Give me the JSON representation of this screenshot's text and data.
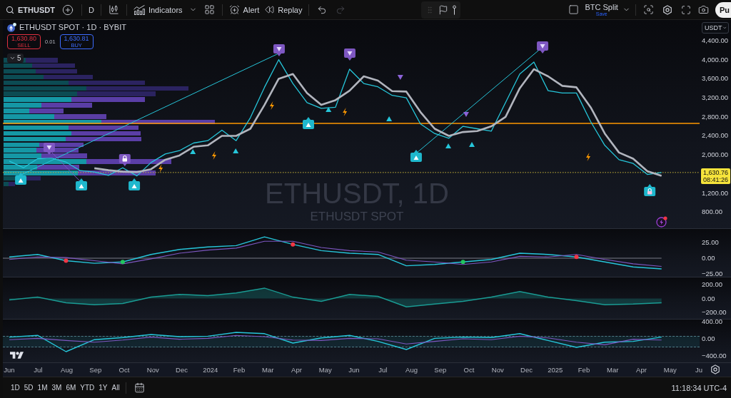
{
  "toolbar": {
    "symbol": "ETHUSDT",
    "interval": "D",
    "indicators": "Indicators",
    "alert": "Alert",
    "replay": "Replay",
    "undo": {
      "disabled": false
    },
    "redo": {
      "disabled": true
    },
    "layout": {
      "name": "BTC Split",
      "status": "Save"
    },
    "publish": "Pu"
  },
  "legend": {
    "title": "ETHUSDT SPOT · 1D · BYBIT",
    "sell": {
      "price": "1,630.80",
      "label": "SELL"
    },
    "spread": "0.01",
    "buy": {
      "price": "1,630.81",
      "label": "BUY"
    },
    "indicator_count": "5"
  },
  "watermark": {
    "symbol": "ETHUSDT, 1D",
    "description": "ETHUSDT SPOT"
  },
  "price_axis": {
    "currency": "USDT",
    "last_price": "1,630.76",
    "countdown": "08:41:26"
  },
  "main_chart": {
    "chart_data": {
      "type": "line",
      "categories": [
        null,
        null,
        null,
        null,
        null,
        null,
        null,
        null,
        null,
        null,
        null,
        null,
        null,
        null,
        null,
        null,
        null,
        null,
        null,
        null,
        null,
        null,
        null,
        null,
        null,
        null,
        null,
        null,
        null,
        null,
        null,
        null,
        null,
        null,
        null,
        null,
        null,
        null,
        null,
        null,
        null,
        null,
        null,
        null,
        null,
        null,
        null
      ],
      "series": [
        {
          "color": "#26c6da",
          "values": [
            1870,
            1730,
            1920,
            1930,
            1850,
            1670,
            1640,
            1570,
            1730,
            1560,
            1840,
            2020,
            2090,
            2250,
            2300,
            2520,
            2300,
            2780,
            3420,
            4000,
            3500,
            3100,
            2980,
            3000,
            3800,
            3500,
            3430,
            3250,
            3200,
            2650,
            2450,
            2350,
            2600,
            2550,
            2500,
            3100,
            3700,
            3950,
            3350,
            3300,
            3300,
            2700,
            2200,
            1900,
            1820,
            1590,
            1630
          ]
        },
        {
          "color": "#b2b5be",
          "values": [
            null,
            null,
            null,
            null,
            null,
            null,
            1720,
            1680,
            1650,
            1640,
            1700,
            1900,
            1990,
            2170,
            2200,
            2400,
            2400,
            2550,
            3050,
            3600,
            3700,
            3300,
            3050,
            3150,
            3350,
            3650,
            3560,
            3340,
            3330,
            2900,
            2550,
            2400,
            2480,
            2500,
            2600,
            2800,
            3400,
            3800,
            3650,
            3450,
            3420,
            3000,
            2450,
            2050,
            1920,
            1660,
            1560
          ]
        }
      ],
      "ylim": [
        460,
        4834
      ],
      "yticks": [
        {
          "value": 4400,
          "label": "4,400.00"
        },
        {
          "value": 4000,
          "label": "4,000.00"
        },
        {
          "value": 3600,
          "label": "3,600.00"
        },
        {
          "value": 3200,
          "label": "3,200.00"
        },
        {
          "value": 2800,
          "label": "2,800.00"
        },
        {
          "value": 2400,
          "label": "2,400.00"
        },
        {
          "value": 2000,
          "label": "2,000.00"
        },
        {
          "value": 1200,
          "label": "1,200.00"
        },
        {
          "value": 800,
          "label": "800.00"
        }
      ],
      "ref_lines": [
        {
          "axis": "y",
          "value": 2662
        },
        {
          "axis": "y",
          "value": 1630.76
        }
      ]
    }
  },
  "panes": [
    {
      "crossover_dots": true,
      "chart_data": {
        "type": "line",
        "categories": [
          null,
          null,
          null,
          null,
          null,
          null,
          null,
          null,
          null,
          null,
          null,
          null,
          null,
          null,
          null,
          null,
          null,
          null,
          null,
          null,
          null,
          null,
          null,
          null
        ],
        "series": [
          {
            "color": "#26c6da",
            "values": [
              2,
              6,
              -4,
              -8,
              -6,
              6,
              14,
              18,
              20,
              34,
              22,
              12,
              8,
              6,
              -12,
              -10,
              -6,
              -2,
              8,
              6,
              2,
              -6,
              -14,
              -17
            ]
          },
          {
            "color": "#7e57c2",
            "values": [
              -2,
              2,
              1,
              -4,
              -9,
              -1,
              8,
              13,
              16,
              27,
              27,
              17,
              12,
              10,
              -3,
              -6,
              -10,
              -6,
              3,
              2,
              6,
              -2,
              -9,
              -13
            ]
          }
        ],
        "ylim": [
          -29.5,
          47.7
        ],
        "yticks": [
          {
            "value": 25,
            "label": "25.00"
          },
          {
            "value": 0,
            "label": "0.00"
          },
          {
            "value": -25,
            "label": "−25.00"
          }
        ],
        "ref_lines": [
          {
            "axis": "y",
            "value": 0
          }
        ]
      }
    },
    {
      "chart_data": {
        "type": "area",
        "categories": [
          null,
          null,
          null,
          null,
          null,
          null,
          null,
          null,
          null,
          null,
          null,
          null,
          null,
          null,
          null,
          null,
          null,
          null,
          null,
          null,
          null,
          null,
          null,
          null
        ],
        "series": [
          {
            "color": "#1a9c94",
            "values": [
              -20,
              20,
              -60,
              -90,
              -70,
              20,
              60,
              40,
              80,
              150,
              20,
              -40,
              60,
              30,
              -120,
              -80,
              -40,
              20,
              100,
              20,
              -30,
              -90,
              -80,
              -60
            ]
          }
        ],
        "ylim": [
          -292,
          313
        ],
        "yticks": [
          {
            "value": 200,
            "label": "200.00"
          },
          {
            "value": 0,
            "label": "0.00"
          },
          {
            "value": -200,
            "label": "−200.00"
          }
        ]
      }
    },
    {
      "chart_data": {
        "type": "line",
        "categories": [
          null,
          null,
          null,
          null,
          null,
          null,
          null,
          null,
          null,
          null,
          null,
          null,
          null,
          null,
          null,
          null,
          null,
          null,
          null,
          null,
          null,
          null,
          null,
          null
        ],
        "series": [
          {
            "color": "#26c6da",
            "values": [
              40,
              80,
              -300,
              -20,
              30,
              100,
              50,
              60,
              150,
              120,
              -100,
              20,
              80,
              -60,
              -250,
              10,
              40,
              30,
              120,
              -40,
              -200,
              -80,
              -60,
              40
            ]
          },
          {
            "color": "#7e57c2",
            "values": [
              -20,
              10,
              -40,
              -80,
              -30,
              40,
              -10,
              10,
              80,
              50,
              -30,
              -40,
              10,
              0,
              -120,
              -60,
              0,
              -20,
              60,
              20,
              -80,
              -140,
              -10,
              -30
            ]
          }
        ],
        "ylim": [
          -550,
          467
        ],
        "yticks": [
          {
            "value": 400,
            "label": "400.00"
          },
          {
            "value": 0,
            "label": "0.00"
          },
          {
            "value": -400,
            "label": "−400.00"
          }
        ]
      }
    }
  ],
  "time_axis": {
    "labels": [
      "Jun",
      "Jul",
      "Aug",
      "Sep",
      "Oct",
      "Nov",
      "Dec",
      "2024",
      "Feb",
      "Mar",
      "Apr",
      "May",
      "Jun",
      "Jul",
      "Aug",
      "Sep",
      "Oct",
      "Nov",
      "Dec",
      "2025",
      "Feb",
      "Mar",
      "Apr",
      "May",
      "Ju"
    ]
  },
  "bottom_bar": {
    "ranges": [
      "1D",
      "5D",
      "1M",
      "3M",
      "6M",
      "YTD",
      "1Y",
      "All"
    ],
    "clock": "11:18:34 UTC-4"
  }
}
